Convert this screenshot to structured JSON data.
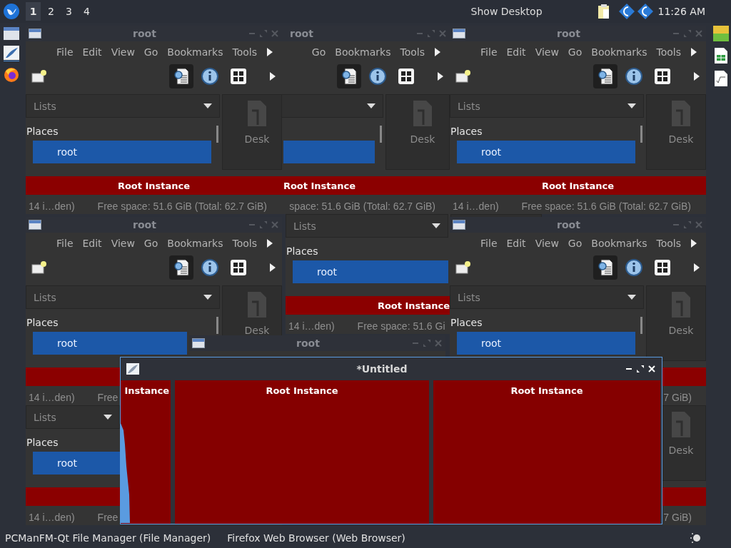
{
  "top_panel": {
    "workspaces": [
      {
        "label": "1",
        "selected": true
      },
      {
        "label": "2",
        "selected": false
      },
      {
        "label": "3",
        "selected": false
      },
      {
        "label": "4",
        "selected": false
      }
    ],
    "show_desktop": "Show Desktop",
    "clock": "11:26 AM"
  },
  "file_windows": [
    {
      "title": "root",
      "menu": [
        "File",
        "Edit",
        "View",
        "Go",
        "Bookmarks",
        "Tools"
      ],
      "toolbar": [
        {
          "kind": "preview",
          "selected": true
        },
        {
          "kind": "info",
          "selected": false
        },
        {
          "kind": "grid",
          "selected": false
        }
      ],
      "sidebar": {
        "dropdown": "Lists",
        "heading": "Places",
        "items": [
          {
            "label": "root",
            "selected": true
          }
        ]
      },
      "view": [
        "Desk"
      ],
      "banner": "Root Instance",
      "status": {
        "left": "14 i…den)",
        "right": "Free space: 51.6 GiB (Total: 62.7 GiB)"
      }
    },
    {
      "title": "root",
      "menu": [
        "Go",
        "Bookmarks",
        "Tools"
      ],
      "toolbar": [
        {
          "kind": "preview",
          "selected": true
        },
        {
          "kind": "info",
          "selected": false
        },
        {
          "kind": "grid",
          "selected": false
        }
      ],
      "sidebar": {
        "items": [
          {
            "selected": true
          }
        ]
      },
      "view": [
        "Desk"
      ],
      "banner": "Root Instance",
      "status": {
        "right": "space: 51.6 GiB (Total: 62.7 GiB)"
      }
    },
    {
      "title": "root",
      "menu": [
        "File",
        "Edit",
        "View",
        "Go",
        "Bookmarks",
        "Tools"
      ],
      "toolbar": [
        {
          "kind": "preview",
          "selected": true
        },
        {
          "kind": "info",
          "selected": false
        },
        {
          "kind": "grid",
          "selected": false
        }
      ],
      "sidebar": {
        "dropdown": "Lists",
        "heading": "Places",
        "items": [
          {
            "label": "root",
            "selected": true
          }
        ]
      },
      "view": [
        "Desk"
      ],
      "banner": "Root Instance",
      "status": {
        "left": "14 i…den)",
        "right": "Free space: 51.6 GiB (Total: 62.7 GiB)"
      }
    },
    {
      "title": "root",
      "menu": [
        "File",
        "Edit",
        "View",
        "Go",
        "Bookmarks",
        "Tools"
      ],
      "toolbar": [
        {
          "kind": "preview",
          "selected": true
        },
        {
          "kind": "info",
          "selected": false
        },
        {
          "kind": "grid",
          "selected": false
        }
      ],
      "sidebar": {
        "dropdown": "Lists",
        "heading": "Places",
        "items": [
          {
            "label": "root",
            "selected": true
          }
        ]
      },
      "view": [
        "Desk"
      ],
      "status": {
        "left": "14 i…den)",
        "right": "Free"
      }
    },
    {
      "sidebar": {
        "dropdown": "Lists",
        "heading": "Places",
        "items": [
          {
            "label": "root",
            "selected": true
          }
        ]
      },
      "banner": "Root Instance",
      "status": {
        "left": "14 i…den)",
        "right": "Free space: 51.6 Gi"
      }
    },
    {
      "title": "root",
      "menu": [
        "File",
        "Edit",
        "View",
        "Go",
        "Bookmarks",
        "Tools"
      ],
      "toolbar": [
        {
          "kind": "preview",
          "selected": true
        },
        {
          "kind": "info",
          "selected": false
        },
        {
          "kind": "grid",
          "selected": false
        }
      ],
      "sidebar": {
        "dropdown": "Lists",
        "heading": "Places",
        "items": [
          {
            "label": "root",
            "selected": true
          }
        ]
      },
      "view": [
        "Desk"
      ],
      "status": {
        "right": "7 GiB)"
      }
    },
    {
      "title": "root"
    },
    {
      "sidebar": {
        "dropdown": "Lists",
        "heading": "Places",
        "items": [
          {
            "label": "root",
            "selected": true
          }
        ]
      },
      "status": {
        "left": "14 i…den)",
        "right": "Free"
      }
    },
    {
      "view": [
        "Desk"
      ],
      "status": {
        "right": "7 GiB)"
      }
    }
  ],
  "paint_window": {
    "title": "*Untitled",
    "canvas_labels": [
      "Instance",
      "Root Instance",
      "Root Instance"
    ]
  },
  "taskbar": {
    "tasks": [
      "PCManFM-Qt File Manager (File Manager)",
      "Firefox Web Browser (Web Browser)"
    ]
  }
}
